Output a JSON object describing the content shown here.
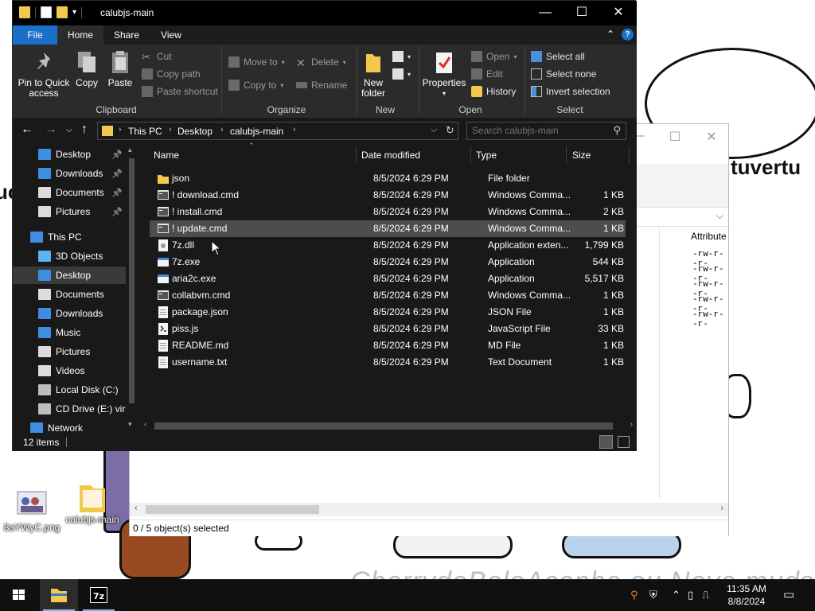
{
  "window": {
    "title": "calubjs-main",
    "minimize": "—",
    "maximize": "☐",
    "close": "✕"
  },
  "tabs": [
    "File",
    "Home",
    "Share",
    "View"
  ],
  "ribbon": {
    "clipboard": {
      "label": "Clipboard",
      "pin": "Pin to Quick access",
      "copy": "Copy",
      "paste": "Paste",
      "cut": "Cut",
      "copy_path": "Copy path",
      "paste_shortcut": "Paste shortcut"
    },
    "organize": {
      "label": "Organize",
      "move_to": "Move to",
      "copy_to": "Copy to",
      "delete": "Delete",
      "rename": "Rename"
    },
    "new": {
      "label": "New",
      "new_folder": "New folder"
    },
    "open": {
      "label": "Open",
      "properties": "Properties",
      "open": "Open",
      "edit": "Edit",
      "history": "History"
    },
    "select": {
      "label": "Select",
      "select_all": "Select all",
      "select_none": "Select none",
      "invert": "Invert selection"
    }
  },
  "address": {
    "crumbs": [
      "This PC",
      "Desktop",
      "calubjs-main"
    ],
    "search_placeholder": "Search calubjs-main"
  },
  "nav": {
    "quick": [
      {
        "label": "Desktop",
        "pinned": true
      },
      {
        "label": "Downloads",
        "pinned": true
      },
      {
        "label": "Documents",
        "pinned": true
      },
      {
        "label": "Pictures",
        "pinned": true
      }
    ],
    "this_pc": "This PC",
    "pc_items": [
      "3D Objects",
      "Desktop",
      "Documents",
      "Downloads",
      "Music",
      "Pictures",
      "Videos",
      "Local Disk (C:)",
      "CD Drive (E:) virt"
    ],
    "network": "Network"
  },
  "columns": {
    "name": "Name",
    "date": "Date modified",
    "type": "Type",
    "size": "Size"
  },
  "files": [
    {
      "name": "json",
      "date": "8/5/2024 6:29 PM",
      "type": "File folder",
      "size": "",
      "icon": "folder-icon"
    },
    {
      "name": "! download.cmd",
      "date": "8/5/2024 6:29 PM",
      "type": "Windows Comma...",
      "size": "1 KB",
      "icon": "cmd-file-icon"
    },
    {
      "name": "! install.cmd",
      "date": "8/5/2024 6:29 PM",
      "type": "Windows Comma...",
      "size": "2 KB",
      "icon": "cmd-file-icon"
    },
    {
      "name": "! update.cmd",
      "date": "8/5/2024 6:29 PM",
      "type": "Windows Comma...",
      "size": "1 KB",
      "icon": "cmd-file-icon"
    },
    {
      "name": "7z.dll",
      "date": "8/5/2024 6:29 PM",
      "type": "Application exten...",
      "size": "1,799 KB",
      "icon": "dll-file-icon"
    },
    {
      "name": "7z.exe",
      "date": "8/5/2024 6:29 PM",
      "type": "Application",
      "size": "544 KB",
      "icon": "exe-file-icon"
    },
    {
      "name": "aria2c.exe",
      "date": "8/5/2024 6:29 PM",
      "type": "Application",
      "size": "5,517 KB",
      "icon": "exe-file-icon"
    },
    {
      "name": "collabvm.cmd",
      "date": "8/5/2024 6:29 PM",
      "type": "Windows Comma...",
      "size": "1 KB",
      "icon": "cmd-file-icon"
    },
    {
      "name": "package.json",
      "date": "8/5/2024 6:29 PM",
      "type": "JSON File",
      "size": "1 KB",
      "icon": "text-file-icon"
    },
    {
      "name": "piss.js",
      "date": "8/5/2024 6:29 PM",
      "type": "JavaScript File",
      "size": "33 KB",
      "icon": "js-file-icon"
    },
    {
      "name": "README.md",
      "date": "8/5/2024 6:29 PM",
      "type": "MD File",
      "size": "1 KB",
      "icon": "text-file-icon"
    },
    {
      "name": "username.txt",
      "date": "8/5/2024 6:29 PM",
      "type": "Text Document",
      "size": "1 KB",
      "icon": "text-file-icon"
    }
  ],
  "status": {
    "items": "12 items"
  },
  "bg_window": {
    "column": "Attribute",
    "attrs": [
      "-rw-r--r-",
      "-rw-r--r-",
      "-rw-r--r-",
      "-rw-r--r-",
      "-rw-r--r-"
    ],
    "status": "0 / 5 object(s) selected"
  },
  "desktop": {
    "wall_text_right": "tuvertu",
    "wall_text_left": "uc",
    "watermark": "CherrydoBoloAconha ou Neva.muds",
    "icons": [
      "8aYWyC.png",
      "calubjs-main"
    ]
  },
  "taskbar": {
    "time": "11:35 AM",
    "date": "8/8/2024"
  },
  "colors": {
    "accent": "#1a6fc9",
    "folder": "#f2c94c",
    "window_bg": "#191919",
    "ribbon_bg": "#2b2b2b"
  }
}
